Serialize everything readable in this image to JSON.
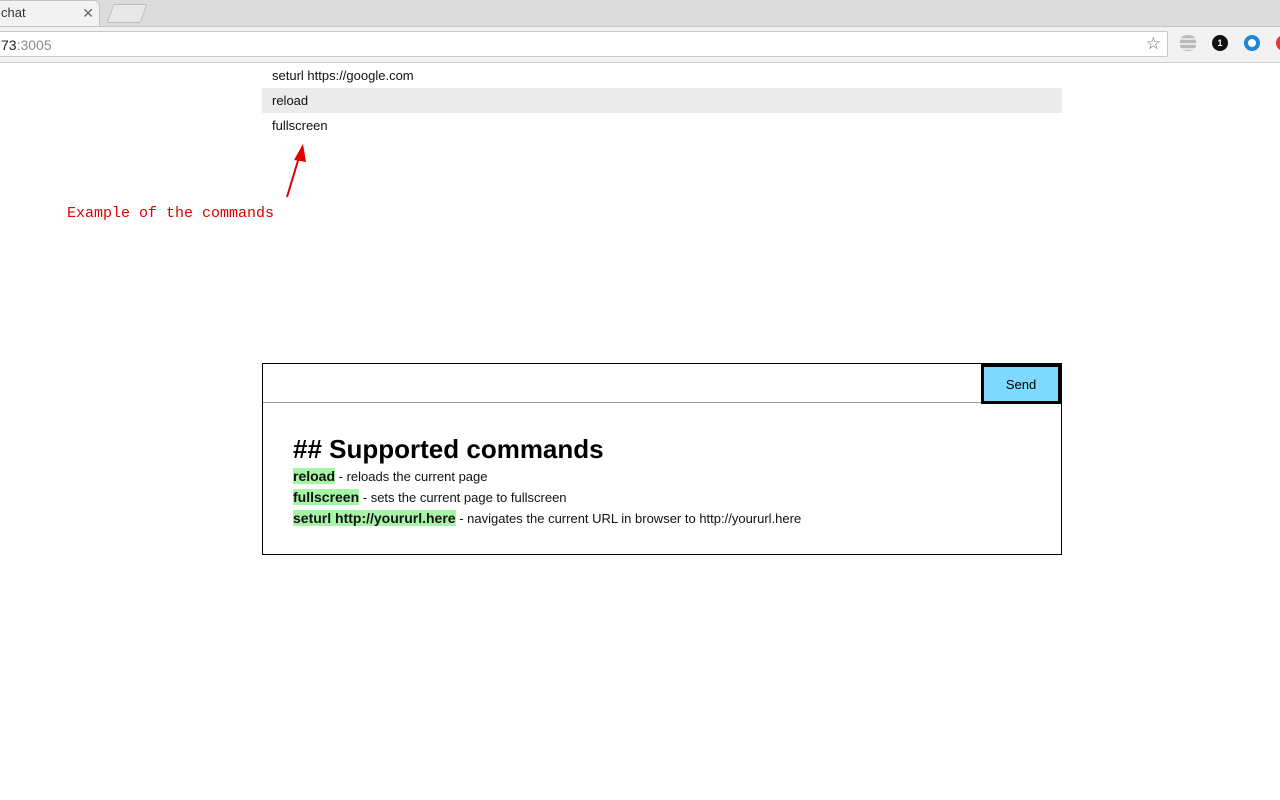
{
  "browser": {
    "tab_title": "chat",
    "tab_close": "✕",
    "url_host_part": "73",
    "url_port": ":3005",
    "extensions": [
      "database-icon",
      "1password-icon",
      "circle-o-icon",
      "red-icon"
    ],
    "ext_1_label": "1"
  },
  "command_list": {
    "items": [
      "seturl https://google.com",
      "reload",
      "fullscreen"
    ],
    "highlighted_index": 1
  },
  "annotation": {
    "text": "Example of the commands",
    "color": "#e00000"
  },
  "chat": {
    "input_value": "",
    "send_label": "Send",
    "send_color": "#7dd9fd"
  },
  "help": {
    "title": "## Supported commands",
    "commands": [
      {
        "name": "reload",
        "desc": " - reloads the current page"
      },
      {
        "name": "fullscreen",
        "desc": " - sets the current page to fullscreen"
      },
      {
        "name": "seturl http://yoururl.here",
        "desc": " - navigates the current URL in browser to http://yoururl.here"
      }
    ],
    "highlight_color": "#a6f5a6"
  }
}
